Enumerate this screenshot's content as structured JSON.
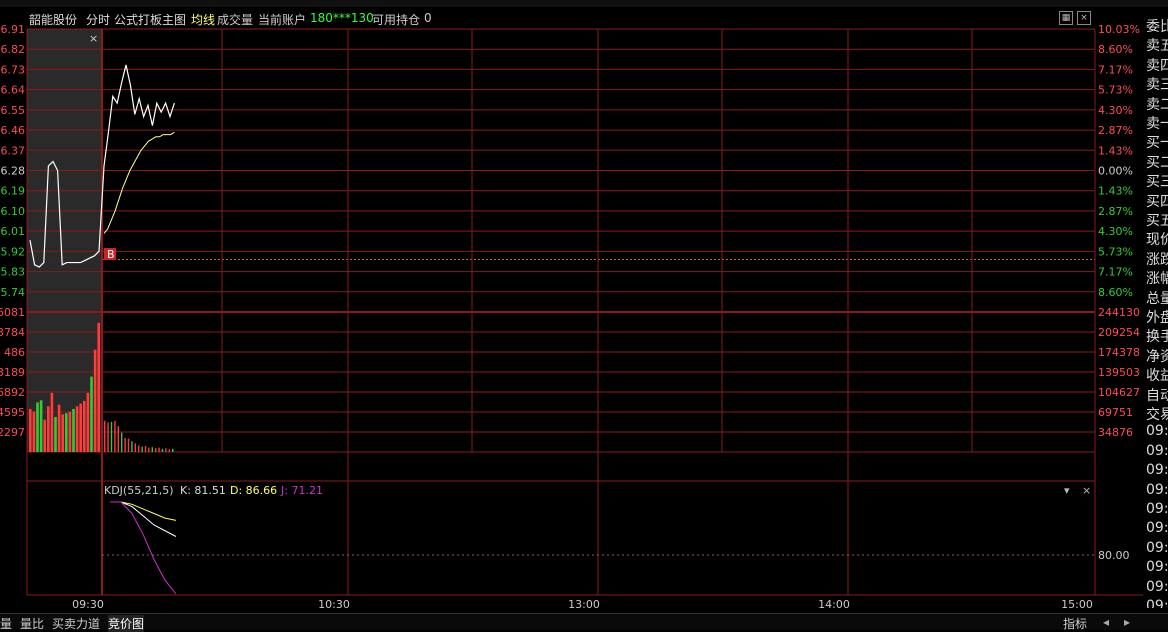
{
  "header": {
    "stock_name": "韶能股份",
    "mode": "分时",
    "formula": "公式打板主图",
    "avg_line_label": "均线",
    "volume_label": "成交量",
    "account_label": "当前账户",
    "account_id": "180***130",
    "holdings_label": "可用持仓",
    "holdings_value": "0"
  },
  "price_axis": {
    "left_labels": [
      "6.91",
      "6.82",
      "6.73",
      "6.64",
      "6.55",
      "6.46",
      "6.37",
      "6.28",
      "6.19",
      "6.10",
      "6.01",
      "5.92",
      "5.83",
      "5.74"
    ],
    "right_labels": [
      "10.03%",
      "8.60%",
      "7.17%",
      "5.73%",
      "4.30%",
      "2.87%",
      "1.43%",
      "0.00%",
      "1.43%",
      "2.87%",
      "4.30%",
      "5.73%",
      "7.17%",
      "8.60%"
    ]
  },
  "volume_axis": {
    "left_labels": [
      "6081",
      "3784",
      "486",
      "3189",
      "6892",
      "4595",
      "2297"
    ],
    "right_labels": [
      "244130",
      "209254",
      "174378",
      "139503",
      "104627",
      "69751",
      "34876"
    ]
  },
  "kdj": {
    "name": "KDJ(55,21,5)",
    "k": "K: 81.51",
    "d": "D: 86.66",
    "j": "J: 71.21",
    "level_label": "80.00"
  },
  "time_axis": [
    "09:30",
    "10:30",
    "13:00",
    "14:00",
    "15:00"
  ],
  "buy_marker": "B",
  "right_panel": [
    "委比",
    "卖五",
    "卖四",
    "卖三",
    "卖二",
    "卖一",
    "买一",
    "买二",
    "买三",
    "买四",
    "买五",
    "现价",
    "涨跌",
    "涨幅",
    "总量",
    "外盘",
    "换手",
    "净资",
    "收益",
    "自动",
    "交易",
    "09:",
    "09:",
    "09:",
    "09:",
    "09:",
    "09:",
    "09:",
    "09:",
    "09:",
    "09:"
  ],
  "bottom_tabs": [
    "量",
    "量比",
    "买卖力道",
    "竞价图"
  ],
  "bottom_right": "指标",
  "colors": {
    "grid": "#8b1a1a",
    "up": "#ff3b3b",
    "down": "#33cc33",
    "price_line": "#ffffff",
    "avg_line": "#ffff99",
    "kdj_k": "#ffffff",
    "kdj_d": "#ffff66",
    "kdj_j": "#cc33cc",
    "axis_label_up": "#ff4d4d",
    "axis_label_down": "#33cc33",
    "account_text": "#33ff33"
  },
  "chart_data": {
    "type": "line",
    "title": "韶能股份 分时",
    "preclose": 6.28,
    "price_series": {
      "name": "price",
      "values": [
        5.97,
        5.86,
        5.85,
        5.87,
        6.3,
        6.32,
        6.28,
        5.86,
        5.87,
        5.87,
        5.87,
        5.87,
        5.88,
        5.89,
        5.9,
        5.92,
        6.3,
        6.45,
        6.61,
        6.58,
        6.67,
        6.75,
        6.66,
        6.53,
        6.6,
        6.52,
        6.57,
        6.48,
        6.58,
        6.54,
        6.58,
        6.52,
        6.58
      ]
    },
    "avg_series": {
      "name": "avg",
      "values": [
        6.0,
        6.02,
        6.06,
        6.1,
        6.15,
        6.2,
        6.24,
        6.28,
        6.31,
        6.34,
        6.37,
        6.39,
        6.41,
        6.42,
        6.43,
        6.43,
        6.44,
        6.44,
        6.44,
        6.45
      ]
    },
    "volume_values": [
      80000,
      75000,
      92000,
      96000,
      60000,
      85000,
      110000,
      65000,
      88000,
      70000,
      72000,
      75000,
      80000,
      85000,
      90000,
      95000,
      110000,
      140000,
      190000,
      240000,
      58000,
      55000,
      56000,
      58000,
      48000,
      36000,
      26000,
      25000,
      20000,
      16000,
      12000,
      10000,
      11000,
      8000,
      9000,
      7000,
      8000,
      6000,
      7000,
      5000,
      6000
    ],
    "kdj": {
      "k": [
        100,
        100,
        96,
        88,
        80,
        75,
        70
      ],
      "d": [
        100,
        100,
        98,
        94,
        90,
        86,
        84
      ],
      "j": [
        100,
        100,
        90,
        72,
        50,
        32,
        20
      ]
    },
    "ylim": [
      5.65,
      6.91
    ]
  }
}
